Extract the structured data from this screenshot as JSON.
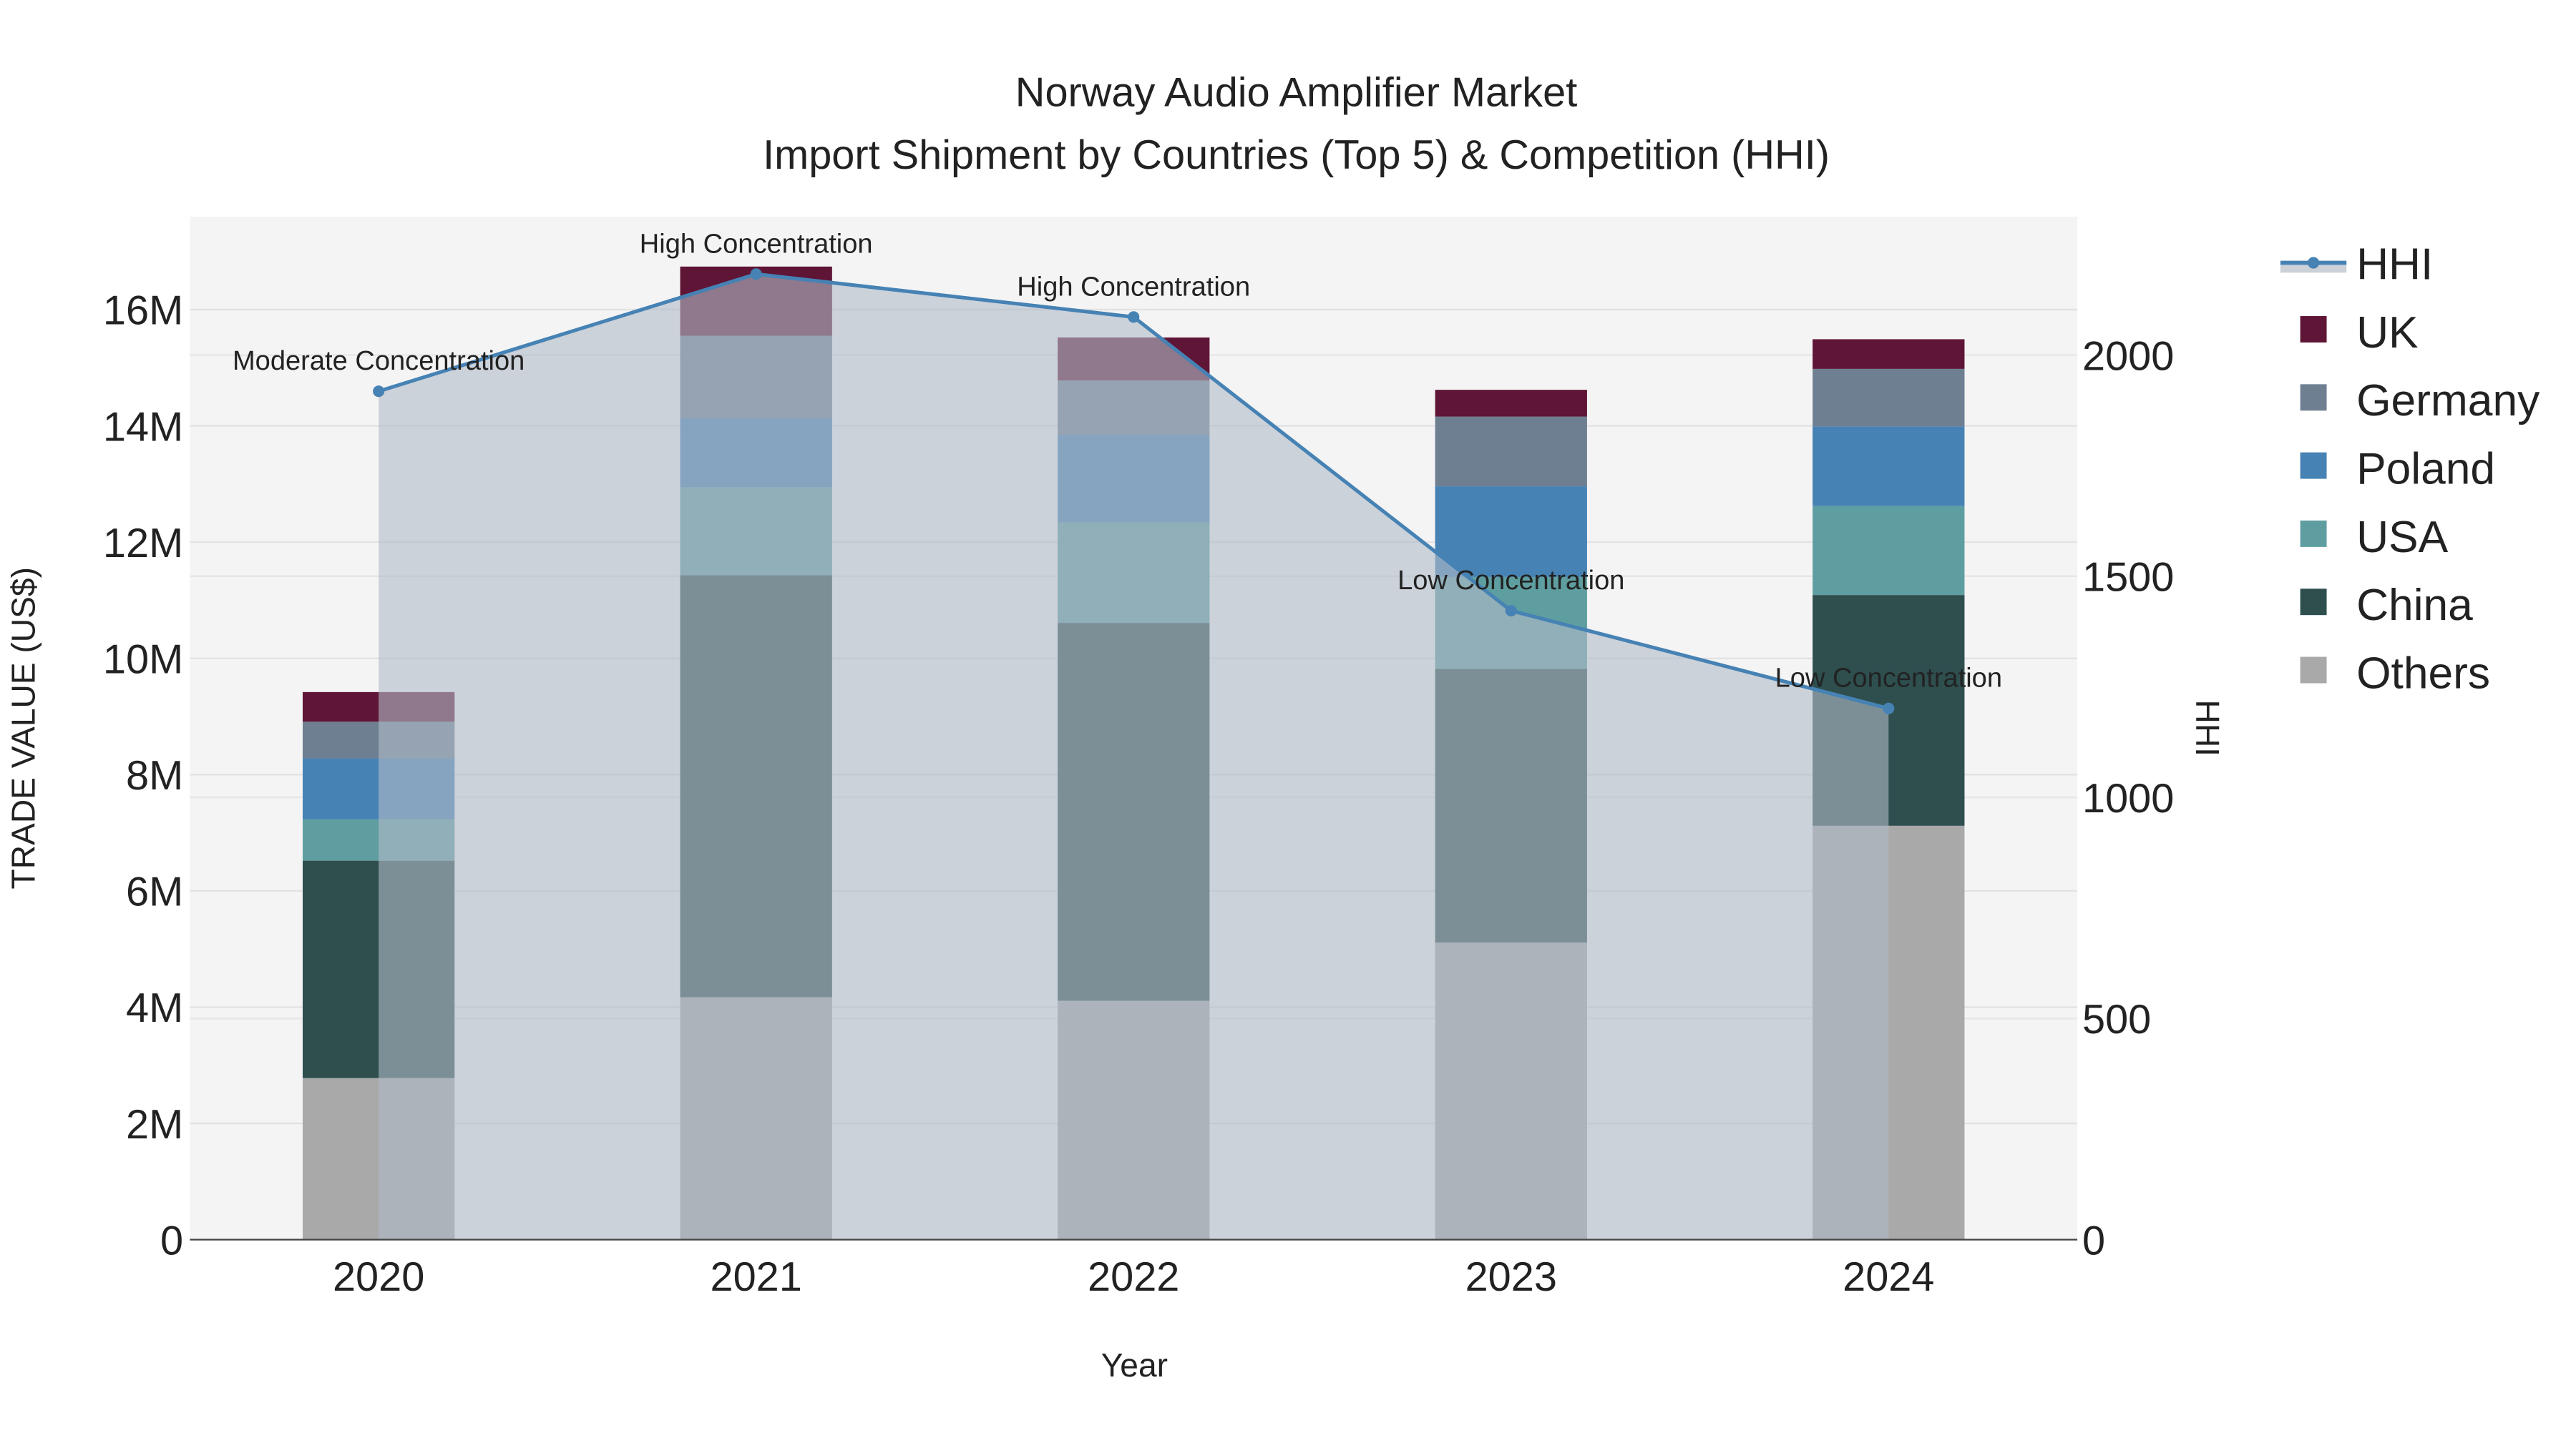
{
  "chart_data": {
    "type": "bar",
    "title": "Norway Audio Amplifier Market",
    "subtitle": "Import Shipment by Countries (Top 5) & Competition (HHI)",
    "xlabel": "Year",
    "ylabel": "TRADE VALUE (US$)",
    "y2label": "HHI",
    "categories": [
      "2020",
      "2021",
      "2022",
      "2023",
      "2024"
    ],
    "ylim": [
      0,
      17.6
    ],
    "y_unit": "M",
    "y_ticks": [
      0,
      2,
      4,
      6,
      8,
      10,
      12,
      14,
      16
    ],
    "y_tick_labels": [
      "0",
      "2M",
      "4M",
      "6M",
      "8M",
      "10M",
      "12M",
      "14M",
      "16M"
    ],
    "y2lim": [
      0,
      2313
    ],
    "y2_ticks": [
      0,
      500,
      1000,
      1500,
      2000
    ],
    "y2_tick_labels": [
      "0",
      "500",
      "1000",
      "1500",
      "2000"
    ],
    "grid": true,
    "legend_placement": "right",
    "series": [
      {
        "name": "Others",
        "color": "#a9a9a9",
        "values": [
          2.78,
          4.17,
          4.11,
          5.11,
          7.12
        ]
      },
      {
        "name": "China",
        "color": "#2f4f4f",
        "values": [
          3.74,
          7.26,
          6.5,
          4.71,
          3.97
        ]
      },
      {
        "name": "USA",
        "color": "#5f9ea0",
        "values": [
          0.71,
          1.51,
          1.73,
          1.58,
          1.53
        ]
      },
      {
        "name": "Poland",
        "color": "#4682b4",
        "values": [
          1.05,
          1.19,
          1.5,
          1.56,
          1.37
        ]
      },
      {
        "name": "Germany",
        "color": "#6e7f91",
        "values": [
          0.63,
          1.42,
          0.94,
          1.2,
          0.99
        ]
      },
      {
        "name": "UK",
        "color": "#5f1536",
        "values": [
          0.51,
          1.19,
          0.74,
          0.46,
          0.51
        ]
      }
    ],
    "hhi": {
      "name": "HHI",
      "color": "#4682b4",
      "values": [
        1918,
        2183,
        2086,
        1422,
        1201
      ],
      "annotations": [
        "Moderate Concentration",
        "High Concentration",
        "High Concentration",
        "Low Concentration",
        "Low Concentration"
      ]
    },
    "legend": [
      "HHI",
      "UK",
      "Germany",
      "Poland",
      "USA",
      "China",
      "Others"
    ]
  }
}
